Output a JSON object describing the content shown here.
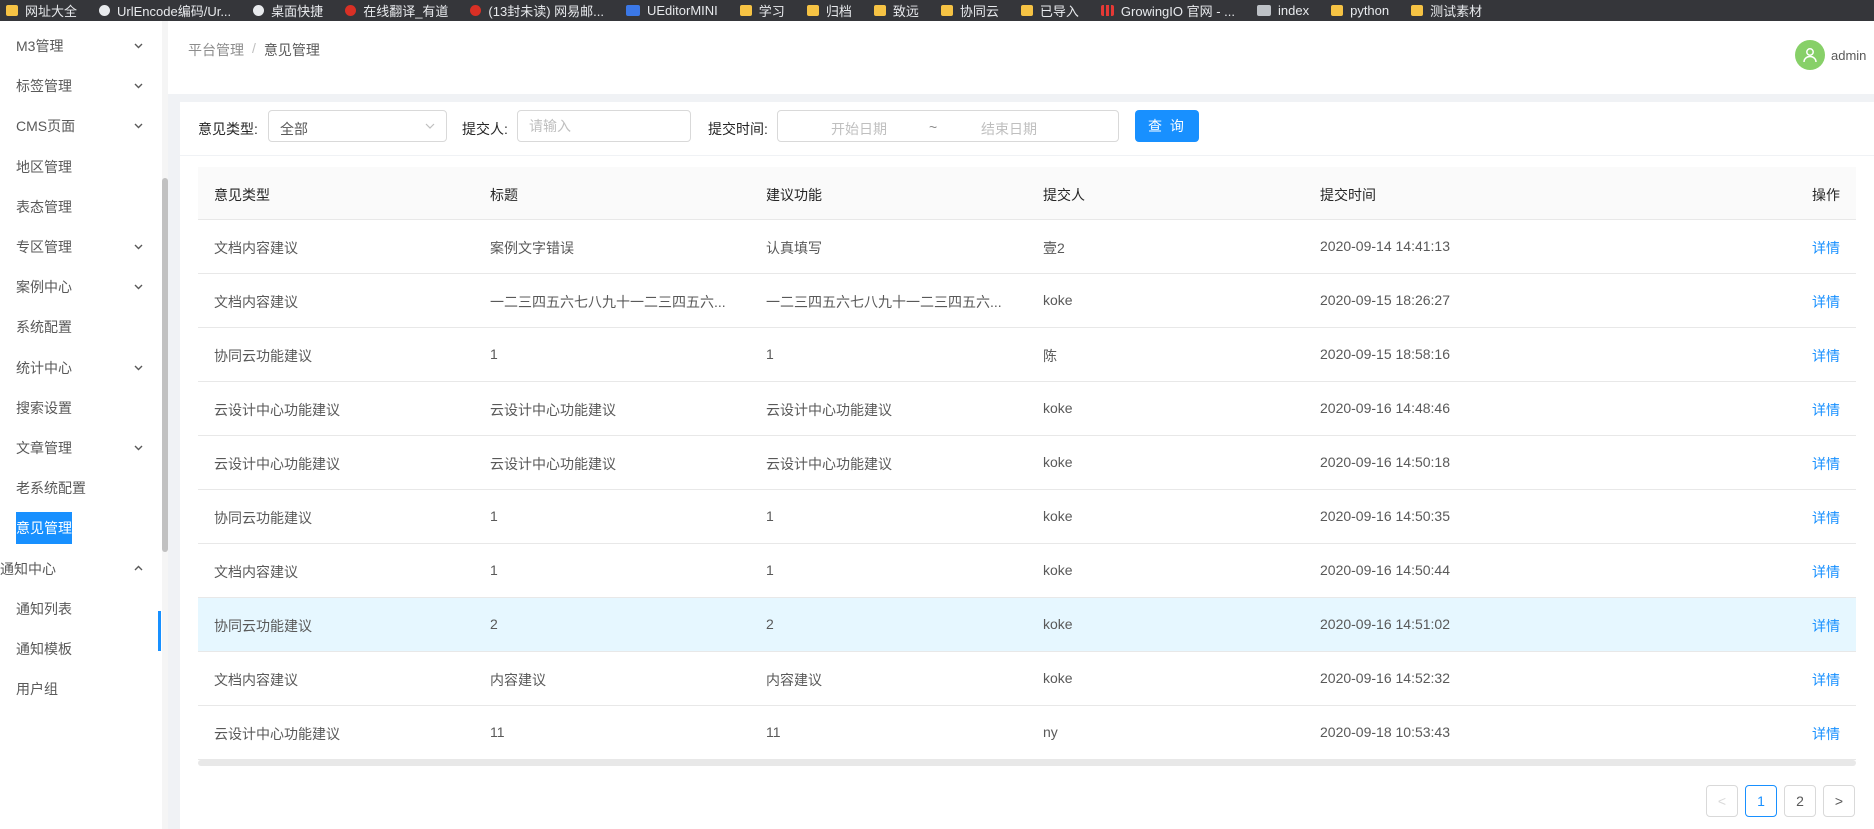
{
  "bookmarks": [
    {
      "label": "网址大全",
      "icon": "folder-icon"
    },
    {
      "label": "UrlEncode编码/Ur...",
      "icon": "globe-icon"
    },
    {
      "label": "桌面快捷",
      "icon": "globe-icon"
    },
    {
      "label": "在线翻译_有道",
      "icon": "youdao-icon"
    },
    {
      "label": "(13封未读) 网易邮...",
      "icon": "netease-icon"
    },
    {
      "label": "UEditorMINI",
      "icon": "ue-icon"
    },
    {
      "label": "学习",
      "icon": "folder-icon"
    },
    {
      "label": "归档",
      "icon": "folder-icon"
    },
    {
      "label": "致远",
      "icon": "folder-icon"
    },
    {
      "label": "协同云",
      "icon": "folder-icon"
    },
    {
      "label": "已导入",
      "icon": "folder-icon"
    },
    {
      "label": "GrowingIO 官网 - ...",
      "icon": "growingio-icon"
    },
    {
      "label": "index",
      "icon": "code-icon"
    },
    {
      "label": "python",
      "icon": "folder-icon"
    },
    {
      "label": "测试素材",
      "icon": "folder-icon"
    }
  ],
  "sidebar": {
    "items": [
      {
        "label": "M3管理",
        "expandable": true
      },
      {
        "label": "标签管理",
        "expandable": true
      },
      {
        "label": "CMS页面",
        "expandable": true
      },
      {
        "label": "地区管理",
        "expandable": false
      },
      {
        "label": "表态管理",
        "expandable": false
      },
      {
        "label": "专区管理",
        "expandable": true
      },
      {
        "label": "案例中心",
        "expandable": true
      },
      {
        "label": "系统配置",
        "expandable": false
      },
      {
        "label": "统计中心",
        "expandable": true
      },
      {
        "label": "搜索设置",
        "expandable": false
      },
      {
        "label": "文章管理",
        "expandable": true
      },
      {
        "label": "老系统配置",
        "expandable": false
      },
      {
        "label": "意见管理",
        "expandable": false,
        "active": true
      },
      {
        "label": "通知中心",
        "expandable": true,
        "open": true
      },
      {
        "label": "通知列表",
        "expandable": false
      },
      {
        "label": "通知模板",
        "expandable": false
      },
      {
        "label": "用户组",
        "expandable": false
      }
    ]
  },
  "header": {
    "breadcrumb": [
      "平台管理",
      "意见管理"
    ],
    "breadcrumb_sep": "/",
    "user_name": "admin"
  },
  "filter": {
    "type_label": "意见类型:",
    "type_value": "全部",
    "submitter_label": "提交人:",
    "submitter_placeholder": "请输入",
    "time_label": "提交时间:",
    "start_placeholder": "开始日期",
    "range_sep": "~",
    "end_placeholder": "结束日期",
    "query_button": "查 询"
  },
  "table": {
    "columns": [
      "意见类型",
      "标题",
      "建议功能",
      "提交人",
      "提交时间",
      "操作"
    ],
    "rows": [
      {
        "type": "文档内容建议",
        "title": "案例文字错误",
        "feature": "认真填写",
        "submitter": "壹2",
        "time": "2020-09-14 14:41:13",
        "action": "详情"
      },
      {
        "type": "文档内容建议",
        "title": "一二三四五六七八九十一二三四五六...",
        "feature": "一二三四五六七八九十一二三四五六...",
        "submitter": "koke",
        "time": "2020-09-15 18:26:27",
        "action": "详情"
      },
      {
        "type": "协同云功能建议",
        "title": "1",
        "feature": "1",
        "submitter": "陈",
        "time": "2020-09-15 18:58:16",
        "action": "详情"
      },
      {
        "type": "云设计中心功能建议",
        "title": "云设计中心功能建议",
        "feature": "云设计中心功能建议",
        "submitter": "koke",
        "time": "2020-09-16 14:48:46",
        "action": "详情"
      },
      {
        "type": "云设计中心功能建议",
        "title": "云设计中心功能建议",
        "feature": "云设计中心功能建议",
        "submitter": "koke",
        "time": "2020-09-16 14:50:18",
        "action": "详情"
      },
      {
        "type": "协同云功能建议",
        "title": "1",
        "feature": "1",
        "submitter": "koke",
        "time": "2020-09-16 14:50:35",
        "action": "详情"
      },
      {
        "type": "文档内容建议",
        "title": "1",
        "feature": "1",
        "submitter": "koke",
        "time": "2020-09-16 14:50:44",
        "action": "详情"
      },
      {
        "type": "协同云功能建议",
        "title": "2",
        "feature": "2",
        "submitter": "koke",
        "time": "2020-09-16 14:51:02",
        "action": "详情",
        "highlight": true
      },
      {
        "type": "文档内容建议",
        "title": "内容建议",
        "feature": "内容建议",
        "submitter": "koke",
        "time": "2020-09-16 14:52:32",
        "action": "详情"
      },
      {
        "type": "云设计中心功能建议",
        "title": "11",
        "feature": "11",
        "submitter": "ny",
        "time": "2020-09-18 10:53:43",
        "action": "详情"
      }
    ]
  },
  "pagination": {
    "prev": "<",
    "pages": [
      "1",
      "2"
    ],
    "current": "1",
    "next": ">"
  },
  "colors": {
    "primary": "#1890ff",
    "avatar": "#87d068",
    "highlight_row": "#e6f7ff"
  }
}
